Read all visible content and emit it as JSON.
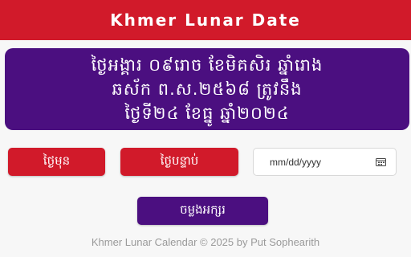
{
  "header": {
    "title": "Khmer Lunar Date"
  },
  "lunar_date": {
    "line1": "ថ្ងៃអង្គារ ០៩រោច ខែមិគសិរ ឆ្នាំរោង",
    "line2": "ឆស័ក ព.ស.២៥៦៨ ត្រូវនឹង",
    "line3": "ថ្ងៃទី២៤ ខែធ្នូ ឆ្នាំ២០២៤"
  },
  "controls": {
    "prev_label": "ថ្ងៃមុន",
    "next_label": "ថ្ងៃបន្ទាប់",
    "date_placeholder": "mm/dd/yyyy",
    "convert_label": "ចម្លងអក្សរ"
  },
  "footer": {
    "text": "Khmer Lunar Calendar © 2025 by Put Sophearith"
  },
  "colors": {
    "header_red": "#d11a2a",
    "card_purple": "#4b0f80",
    "button_red": "#d11a2a",
    "button_purple": "#4b0f80"
  },
  "icons": {
    "date_input_icon": "calendar-icon"
  }
}
